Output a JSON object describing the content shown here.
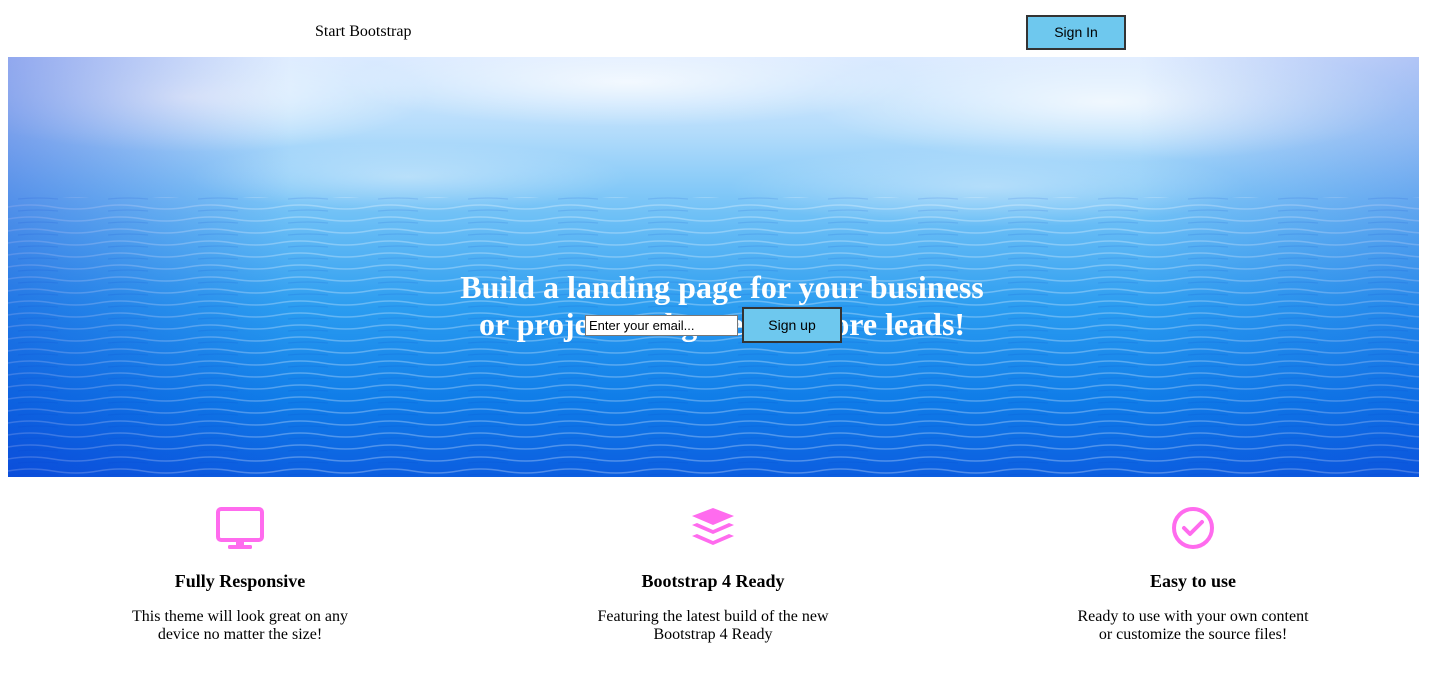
{
  "navbar": {
    "brand": "Start Bootstrap",
    "signin_label": "Sign In"
  },
  "hero": {
    "title_lines": [
      "Build a landing page for your business",
      "or project and generate more leads!"
    ],
    "email_placeholder": "Enter your email...",
    "signup_label": "Sign up"
  },
  "features": [
    {
      "icon": "desktop-monitor-icon",
      "title": "Fully Responsive",
      "text_lines": [
        "This theme will look great on any",
        "device no matter the size!"
      ]
    },
    {
      "icon": "layers-icon",
      "title": "Bootstrap 4 Ready",
      "text_lines": [
        "Featuring the latest build of the new",
        "Bootstrap 4 Ready"
      ]
    },
    {
      "icon": "check-circle-icon",
      "title": "Easy to use",
      "text_lines": [
        "Ready to use with your own content",
        "or customize the source files!"
      ]
    }
  ],
  "colors": {
    "button_bg": "#6ec8ee",
    "icon_color": "#ff6bee",
    "hero_text": "#ffffff"
  }
}
